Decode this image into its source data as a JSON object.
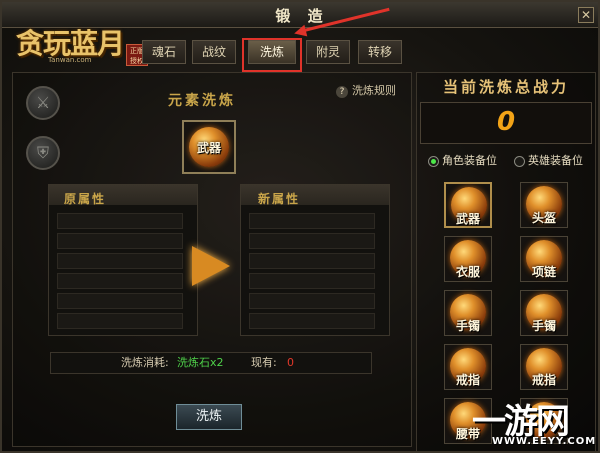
{
  "window": {
    "title": "锻 造",
    "close_glyph": "✕"
  },
  "logo": {
    "title": "贪玩蓝月",
    "url": "Tanwan.com",
    "badge": "正版授权"
  },
  "tabs": [
    {
      "label": "魂石",
      "active": false
    },
    {
      "label": "战纹",
      "active": false
    },
    {
      "label": "洗炼",
      "active": true
    },
    {
      "label": "附灵",
      "active": false
    },
    {
      "label": "转移",
      "active": false
    }
  ],
  "left": {
    "section_title": "元素洗炼",
    "rules_label": "洗炼规则",
    "rules_icon": "?",
    "slot_label": "武器",
    "original_header": "原属性",
    "new_header": "新属性",
    "cost_label": "洗炼消耗:",
    "cost_item": "洗炼石x2",
    "own_label": "现有:",
    "own_value": "0",
    "wash_button": "洗炼",
    "side_icons": [
      "sword-icon",
      "shield-icon"
    ]
  },
  "right": {
    "title": "当前洗炼总战力",
    "power": "0",
    "radio_role": "角色装备位",
    "radio_hero": "英雄装备位",
    "equipment": [
      {
        "label": "武器",
        "selected": true
      },
      {
        "label": "头盔",
        "selected": false
      },
      {
        "label": "衣服",
        "selected": false
      },
      {
        "label": "项链",
        "selected": false
      },
      {
        "label": "手镯",
        "selected": false
      },
      {
        "label": "手镯",
        "selected": false
      },
      {
        "label": "戒指",
        "selected": false
      },
      {
        "label": "戒指",
        "selected": false
      },
      {
        "label": "腰带",
        "selected": false
      },
      {
        "label": "",
        "selected": false
      }
    ]
  },
  "watermark": {
    "main": "一游网",
    "sub": "WWW.EEYY.COM"
  },
  "colors": {
    "accent_gold": "#c9a54a",
    "power_orange": "#f2a317",
    "cost_green": "#4fd24a",
    "own_red": "#e2382a",
    "highlight_red": "#e0332a"
  }
}
